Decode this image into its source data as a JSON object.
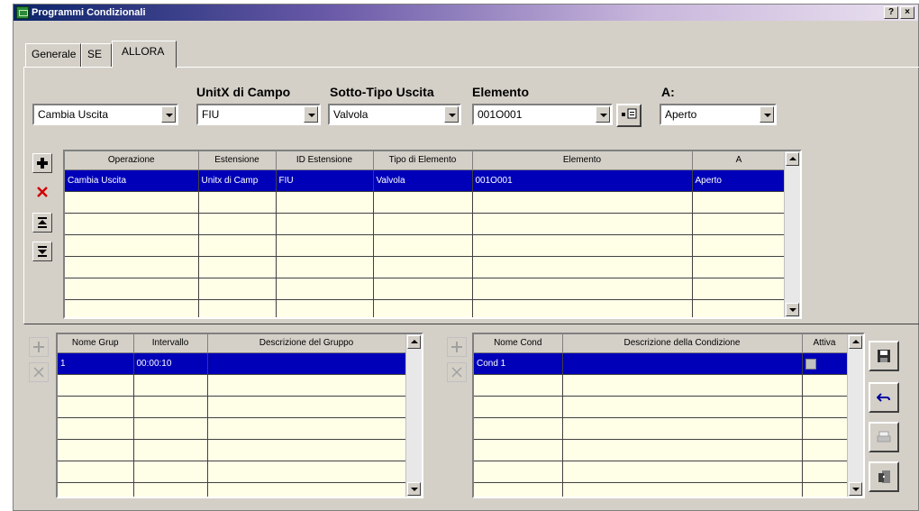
{
  "window": {
    "title": "Programmi Condizionali",
    "help_label": "?",
    "close_label": "×"
  },
  "tabs": [
    {
      "label": "Generale"
    },
    {
      "label": "SE"
    },
    {
      "label": "ALLORA",
      "active": true
    }
  ],
  "fields": {
    "operazione": {
      "value": "Cambia Uscita"
    },
    "unita": {
      "label": "UnitX di Campo",
      "value": "FIU"
    },
    "sottotipo": {
      "label": "Sotto-Tipo Uscita",
      "value": "Valvola"
    },
    "elemento": {
      "label": "Elemento",
      "value": "001O001"
    },
    "a": {
      "label": "A:",
      "value": "Aperto"
    }
  },
  "actions_grid": {
    "columns": [
      "Operazione",
      "Estensione",
      "ID Estensione",
      "Tipo di Elemento",
      "Elemento",
      "A"
    ],
    "rows": [
      [
        "Cambia Uscita",
        "Unitx di Camp",
        "FIU",
        "Valvola",
        "001O001",
        "Aperto"
      ]
    ],
    "empty_rows": 6
  },
  "group_grid": {
    "columns": [
      "Nome Grup",
      "Intervallo",
      "Descrizione del Gruppo"
    ],
    "rows": [
      [
        "1",
        "00:00:10",
        ""
      ]
    ],
    "empty_rows": 6
  },
  "cond_grid": {
    "columns": [
      "Nome Cond",
      "Descrizione della Condizione",
      "Attiva"
    ],
    "rows": [
      [
        "Cond 1",
        "",
        ""
      ]
    ],
    "empty_rows": 6
  },
  "icons": {
    "add": "plus-icon",
    "delete": "red-x-icon",
    "move_top": "move-top-icon",
    "move_bottom": "move-bottom-icon",
    "save": "floppy-icon",
    "undo": "undo-icon",
    "print": "print-icon",
    "exit": "exit-door-icon"
  },
  "colors": {
    "selection": "#0000b8",
    "grid_bg": "#ffffe8",
    "face": "#d4d0c8"
  }
}
